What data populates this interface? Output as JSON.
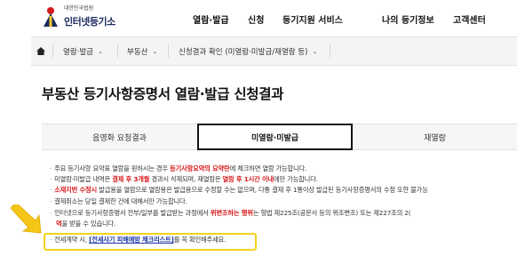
{
  "header": {
    "logo_sub": "대한민국법원",
    "logo_main": "인터넷등기소",
    "nav": [
      "열람·발급",
      "신청",
      "등기지원 서비스",
      "나의 등기정보",
      "고객센터"
    ]
  },
  "breadcrumb": {
    "items": [
      "열람·발급",
      "부동산",
      "신청결과 확인 (미열람·미발급/재열람 등)"
    ]
  },
  "page": {
    "title": "부동산 등기사항증명서 열람·발급 신청결과"
  },
  "tabs": [
    {
      "label": "음영화 요청결과",
      "active": false
    },
    {
      "label": "미열람·미발급",
      "active": true
    },
    {
      "label": "재열람",
      "active": false
    }
  ],
  "notes": {
    "n1_a": "주요 등기사항 요약표 열람을 원하시는 경우 ",
    "n1_b": "등기사항요약의 요약란",
    "n1_c": "에 체크하면 열람 가능합니다.",
    "n2_a": "미열람·미발급 내역은 ",
    "n2_b": "결제 후 3개월",
    "n2_c": " 경과시 삭제되며, 재열람은 ",
    "n2_d": "열람 후 1시간 이내",
    "n2_e": "에만 가능합니다.",
    "n3_a": "소재지번 수정시",
    "n3_b": " 발급용을 열람으로 열람용은 발급용으로 수정할 수는 없으며, 다통 결제 후 1통이상 발급된 등기사항증명서의 수정 또한 불가능",
    "n4": "결제취소는 당일 결제한 건에 대해서만 가능합니다.",
    "n5_a": "인터넷으로 등기사항증명서 전부/일부를 발급받는 과정에서 ",
    "n5_b": "위변조하는 행위",
    "n5_c": "는 형법 제225조(공문서 등의 위조변조) 또는 제227조의 2(",
    "n5_d": "역",
    "n5_e": "을 받을 수 있습니다.",
    "n6_a": "전세계약 시, ",
    "n6_b": "[전세사기 피해예방 체크리스트]",
    "n6_c": "를 꼭 확인해주세요."
  },
  "colors": {
    "accent_red": "#d6191b",
    "link_blue": "#1a36a8",
    "highlight_yellow": "#f5d21a",
    "arrow_yellow": "#f5c518"
  }
}
